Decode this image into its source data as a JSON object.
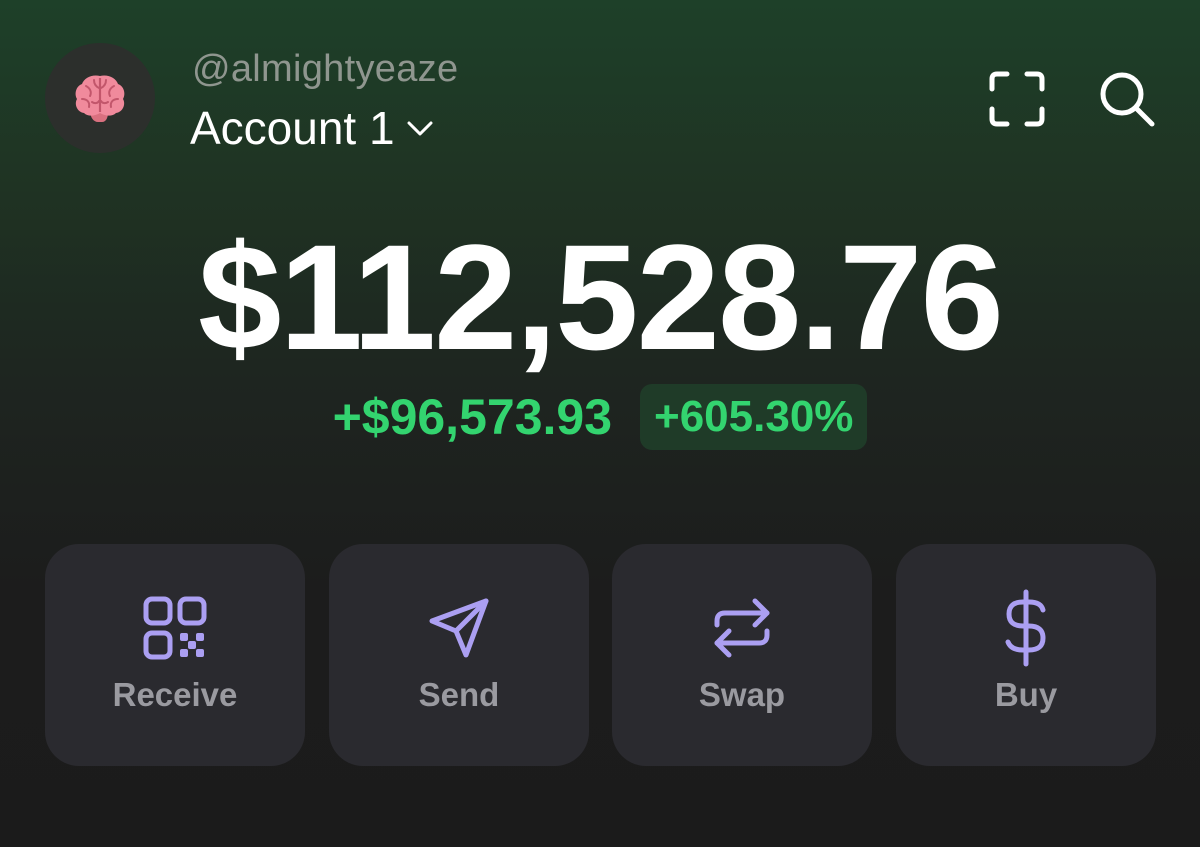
{
  "header": {
    "username": "@almightyeaze",
    "account_name": "Account 1",
    "avatar_icon": "brain-emoji-icon",
    "scan_icon": "scan-icon",
    "search_icon": "search-icon"
  },
  "portfolio": {
    "balance": "$112,528.76",
    "change_amount": "+$96,573.93",
    "change_percent": "+605.30%"
  },
  "actions": [
    {
      "label": "Receive",
      "icon": "qr-code-icon"
    },
    {
      "label": "Send",
      "icon": "send-icon"
    },
    {
      "label": "Swap",
      "icon": "swap-icon"
    },
    {
      "label": "Buy",
      "icon": "dollar-icon"
    }
  ],
  "colors": {
    "positive": "#33d46f",
    "accent": "#ab9ff2",
    "button_bg": "#2a2a2f",
    "label_gray": "#9a9aa0"
  }
}
